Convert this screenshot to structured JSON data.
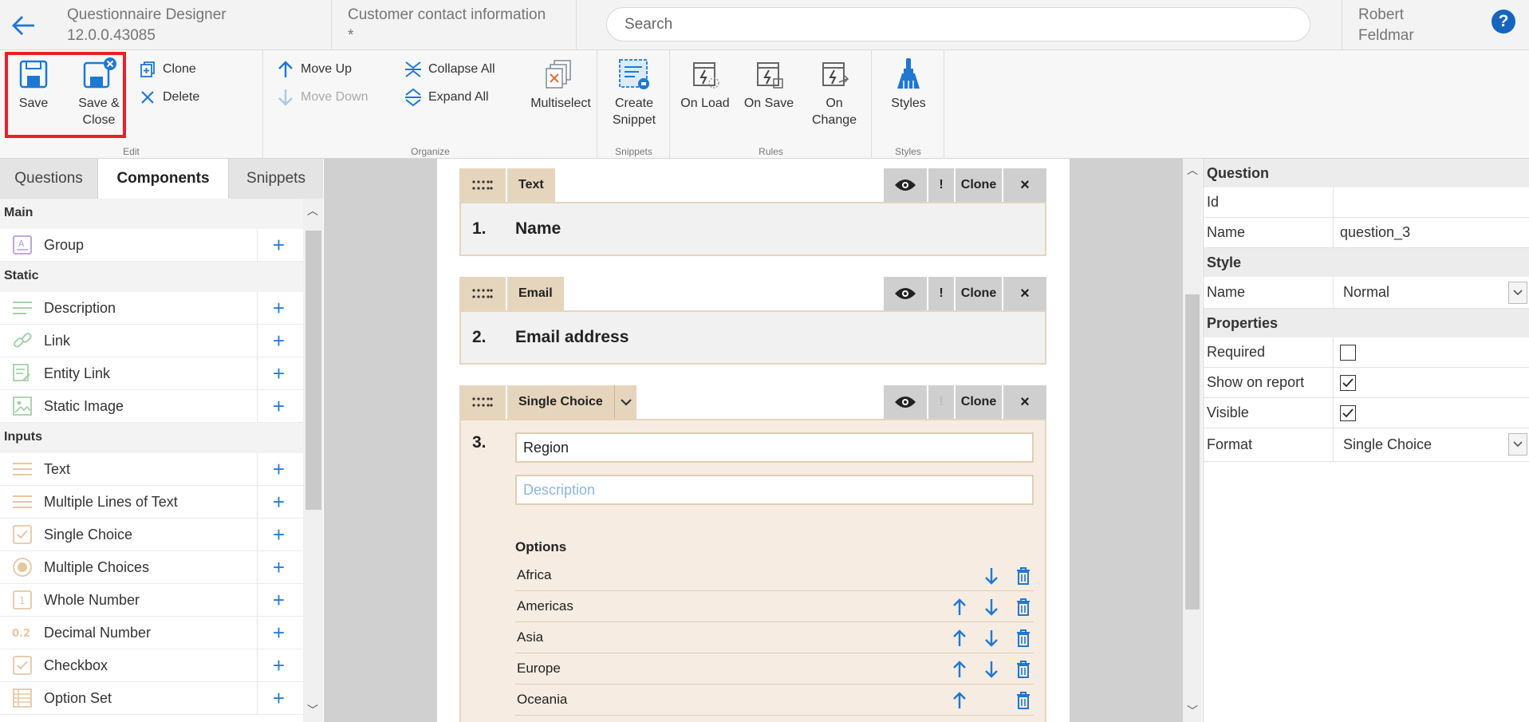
{
  "topbar": {
    "app_name": "Questionnaire Designer",
    "app_version": "12.0.0.43085",
    "doc_title": "Customer contact information",
    "doc_modified": "*",
    "search_placeholder": "Search",
    "user_first": "Robert",
    "user_last": "Feldmar",
    "help_label": "?"
  },
  "ribbon": {
    "edit": {
      "label": "Edit",
      "save": "Save",
      "save_close_1": "Save &",
      "save_close_2": "Close",
      "clone": "Clone",
      "delete": "Delete"
    },
    "organize": {
      "label": "Organize",
      "move_up": "Move Up",
      "move_down": "Move Down",
      "collapse_all": "Collapse All",
      "expand_all": "Expand All",
      "multiselect": "Multiselect"
    },
    "snippets": {
      "label": "Snippets",
      "create_1": "Create",
      "create_2": "Snippet"
    },
    "rules": {
      "label": "Rules",
      "on_load": "On Load",
      "on_save": "On Save",
      "on_change_1": "On",
      "on_change_2": "Change"
    },
    "styles": {
      "label": "Styles",
      "styles": "Styles"
    }
  },
  "left": {
    "tabs": [
      "Questions",
      "Components",
      "Snippets"
    ],
    "active_tab": "Components",
    "sections": {
      "main": {
        "title": "Main",
        "items": [
          "Group"
        ]
      },
      "static": {
        "title": "Static",
        "items": [
          "Description",
          "Link",
          "Entity Link",
          "Static Image"
        ]
      },
      "inputs": {
        "title": "Inputs",
        "items": [
          "Text",
          "Multiple Lines of Text",
          "Single Choice",
          "Multiple Choices",
          "Whole Number",
          "Decimal Number",
          "Checkbox",
          "Option Set"
        ]
      }
    },
    "add_symbol": "+"
  },
  "canvas": {
    "questions": [
      {
        "type": "Text",
        "number": "1.",
        "title": "Name"
      },
      {
        "type": "Email",
        "number": "2.",
        "title": "Email address"
      },
      {
        "type": "Single Choice",
        "number": "3.",
        "title_value": "Region",
        "description_placeholder": "Description",
        "options_title": "Options",
        "options": [
          "Africa",
          "Americas",
          "Asia",
          "Europe",
          "Oceania"
        ]
      }
    ],
    "tool_required": "!",
    "tool_clone": "Clone",
    "tool_close": "×"
  },
  "props": {
    "question": {
      "title": "Question",
      "id_label": "Id",
      "id_value": "",
      "name_label": "Name",
      "name_value": "question_3"
    },
    "style": {
      "title": "Style",
      "name_label": "Name",
      "name_value": "Normal"
    },
    "properties": {
      "title": "Properties",
      "required_label": "Required",
      "required": false,
      "show_label": "Show on report",
      "show": true,
      "visible_label": "Visible",
      "visible": true,
      "format_label": "Format",
      "format_value": "Single Choice"
    }
  },
  "colors": {
    "accent": "#1e78d2",
    "highlight": "#e8202a",
    "question_header": "#e6d5bd"
  }
}
